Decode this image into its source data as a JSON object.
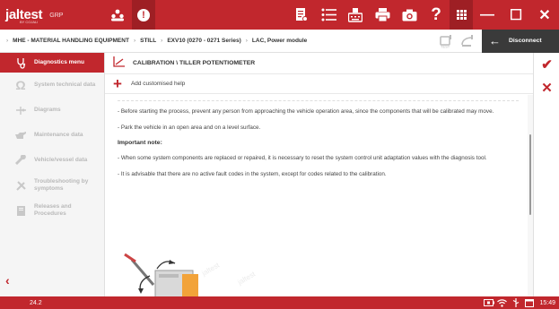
{
  "app": {
    "logo_text": "jaltest",
    "logo_sub": "GRP",
    "logo_tag": "BY COJALI",
    "alert_glyph": "!",
    "accent": "#c1272d",
    "accent_dark": "#9e1f24"
  },
  "window": {
    "minimize": "—",
    "maximize": "☐",
    "close": "✕"
  },
  "breadcrumb": {
    "items": [
      "MHE - MATERIAL HANDLING EQUIPMENT",
      "STILL",
      "EXV10 (0270 - 0271 Series)",
      "LAC, Power module"
    ],
    "disconnect_label": "Disconnect"
  },
  "sidebar": {
    "items": [
      {
        "label": "Diagnostics menu",
        "icon": "diagnostics-icon",
        "active": true
      },
      {
        "label": "System technical data",
        "icon": "omega-icon",
        "active": false
      },
      {
        "label": "Diagrams",
        "icon": "diagram-icon",
        "active": false
      },
      {
        "label": "Maintenance data",
        "icon": "oil-can-icon",
        "active": false
      },
      {
        "label": "Vehicle/vessel data",
        "icon": "wrench-icon",
        "active": false
      },
      {
        "label": "Troubleshooting by symptoms",
        "icon": "tools-icon",
        "active": false
      },
      {
        "label": "Releases and Procedures",
        "icon": "book-icon",
        "active": false
      }
    ],
    "back_glyph": "‹"
  },
  "main": {
    "title": "CALIBRATION \\ TILLER POTENTIOMETER",
    "add_help": "Add customised help",
    "paragraphs": {
      "p1": "- Before starting the process, prevent any person from approaching the vehicle operation area, since the components that will be calibrated may move.",
      "p2": "- Park the vehicle in an open area and on a level surface.",
      "note_title": "Important note:",
      "p3": "- When some system components are replaced or repaired, it is necessary to reset the system control unit adaptation values with the diagnosis tool.",
      "p4": "- It is advisable that there are no active fault codes in the system, except for codes related to the calibration."
    }
  },
  "right_panel": {
    "confirm": "✔",
    "cancel": "✕"
  },
  "status": {
    "version": "24.2",
    "time": "15:49"
  }
}
